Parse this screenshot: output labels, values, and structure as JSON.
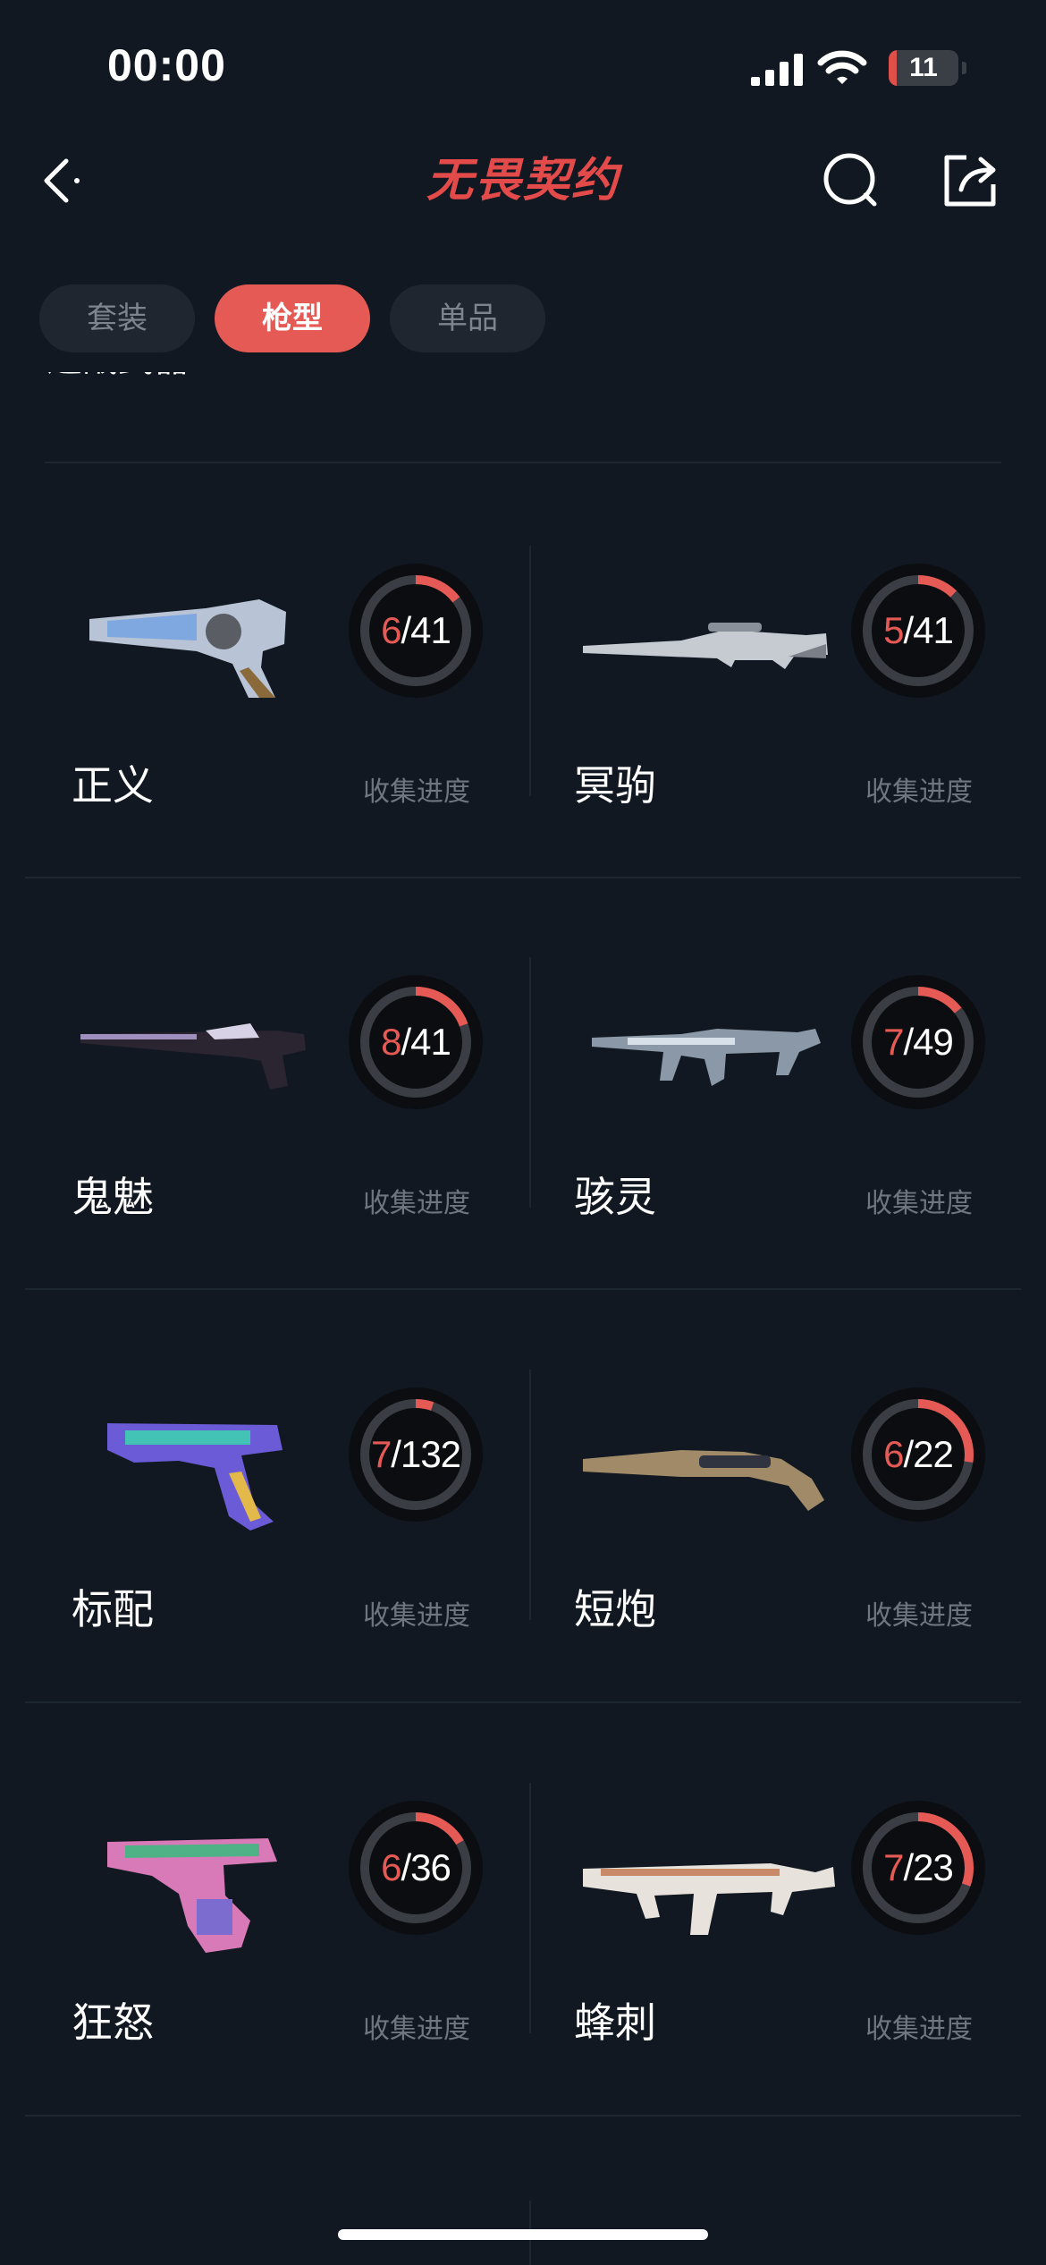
{
  "status_bar": {
    "time": "00:00",
    "battery": "11",
    "battery_level_percent": 11
  },
  "header": {
    "logo_text": "无畏契约",
    "back_icon": "back-icon",
    "search_icon": "search-icon",
    "share_icon": "share-icon"
  },
  "tabs": [
    {
      "label": "套装",
      "active": false
    },
    {
      "label": "枪型",
      "active": true
    },
    {
      "label": "单品",
      "active": false
    }
  ],
  "section_title_partial": "近战武器",
  "colors": {
    "background": "#111821",
    "accent": "#e65a55",
    "ring_track": "#3a3d44",
    "caption": "#6f7680"
  },
  "weapons": [
    {
      "name": "正义",
      "collected": "6",
      "total": "41",
      "caption": "收集进度",
      "progress": 0.146,
      "image": "revolver"
    },
    {
      "name": "冥驹",
      "collected": "5",
      "total": "41",
      "caption": "收集进度",
      "progress": 0.122,
      "image": "sniper"
    },
    {
      "name": "鬼魅",
      "collected": "8",
      "total": "41",
      "caption": "收集进度",
      "progress": 0.195,
      "image": "pistol-suppressed"
    },
    {
      "name": "骇灵",
      "collected": "7",
      "total": "49",
      "caption": "收集进度",
      "progress": 0.143,
      "image": "smg"
    },
    {
      "name": "标配",
      "collected": "7",
      "total": "132",
      "caption": "收集进度",
      "progress": 0.053,
      "image": "pistol"
    },
    {
      "name": "短炮",
      "collected": "6",
      "total": "22",
      "caption": "收集进度",
      "progress": 0.273,
      "image": "shotgun"
    },
    {
      "name": "狂怒",
      "collected": "6",
      "total": "36",
      "caption": "收集进度",
      "progress": 0.167,
      "image": "machine-pistol"
    },
    {
      "name": "蜂刺",
      "collected": "7",
      "total": "23",
      "caption": "收集进度",
      "progress": 0.304,
      "image": "stinger"
    }
  ]
}
